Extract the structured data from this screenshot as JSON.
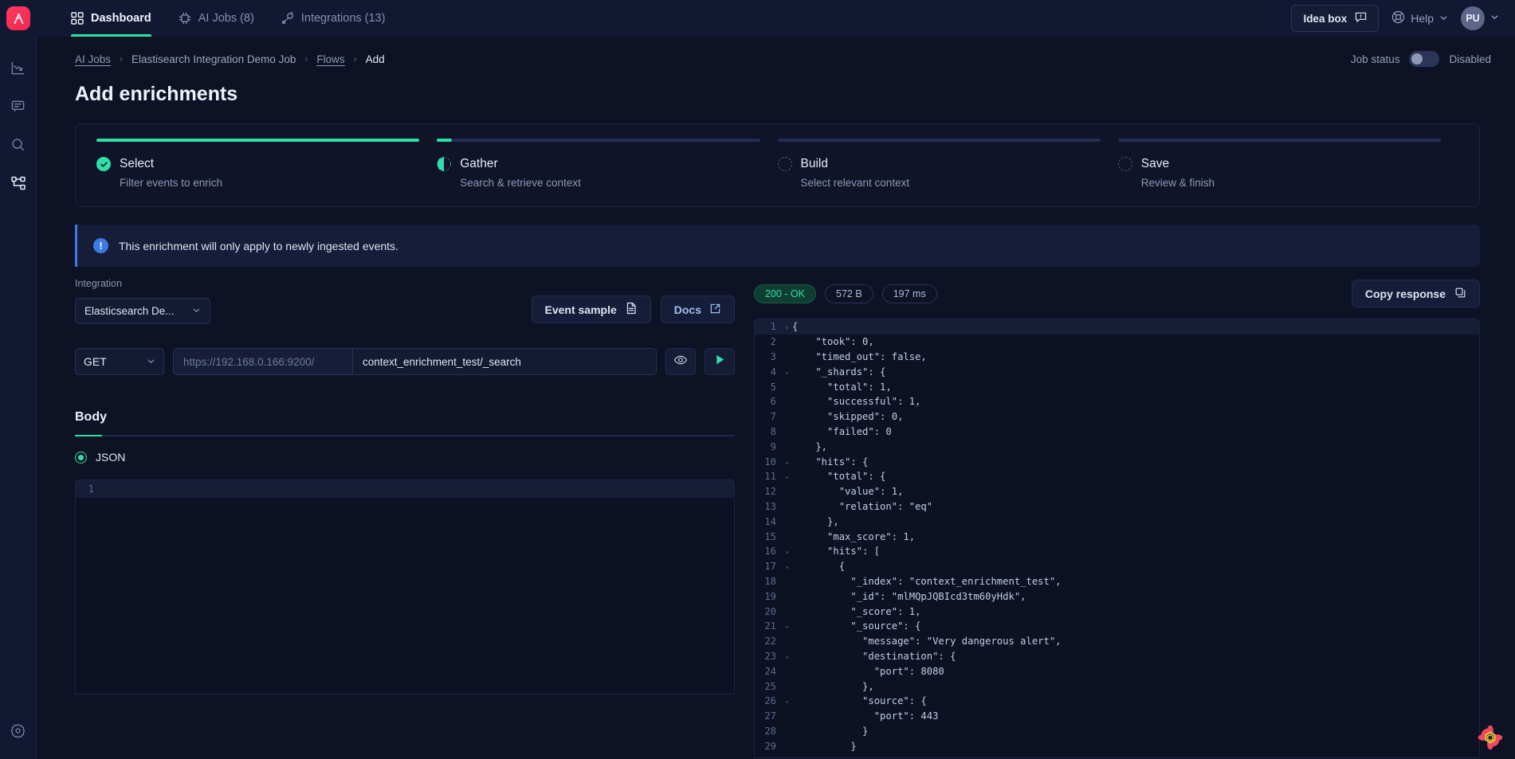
{
  "brand": {
    "logo_text": "Ai",
    "accent": "#2ee0a5",
    "brand_red": "#f2264f"
  },
  "topnav": {
    "tabs": [
      {
        "label": "Dashboard",
        "icon": "grid-icon",
        "active": true
      },
      {
        "label": "AI Jobs (8)",
        "icon": "chip-icon",
        "active": false
      },
      {
        "label": "Integrations (13)",
        "icon": "plug-icon",
        "active": false
      }
    ],
    "idea_box": "Idea box",
    "help": "Help",
    "avatar_initials": "PU"
  },
  "sidebar": {
    "items": [
      {
        "name": "analytics-icon"
      },
      {
        "name": "chat-icon"
      },
      {
        "name": "search-icon"
      },
      {
        "name": "flows-icon"
      }
    ],
    "bottom": {
      "name": "settings-icon"
    }
  },
  "breadcrumb": {
    "items": [
      {
        "label": "AI Jobs",
        "link": true
      },
      {
        "label": "Elastisearch Integration Demo Job",
        "link": false
      },
      {
        "label": "Flows",
        "link": true
      },
      {
        "label": "Add",
        "current": true
      }
    ],
    "separator": "›"
  },
  "job_status": {
    "label": "Job status",
    "value": "Disabled",
    "enabled": false
  },
  "page": {
    "title": "Add enrichments"
  },
  "stepper": {
    "steps": [
      {
        "name": "Select",
        "sub": "Filter events to enrich",
        "state": "done"
      },
      {
        "name": "Gather",
        "sub": "Search & retrieve context",
        "state": "active"
      },
      {
        "name": "Build",
        "sub": "Select relevant context",
        "state": "todo"
      },
      {
        "name": "Save",
        "sub": "Review & finish",
        "state": "todo"
      }
    ]
  },
  "banner": {
    "text": "This enrichment will only apply to newly ingested events.",
    "icon": "exclamation-icon"
  },
  "integration": {
    "label": "Integration",
    "selected": "Elasticsearch De...",
    "event_sample_label": "Event sample",
    "docs_label": "Docs"
  },
  "request": {
    "method": "GET",
    "base_url_placeholder": "https://192.168.0.166:9200/",
    "path": "context_enrichment_test/_search",
    "preview_icon": "eye-icon",
    "run_icon": "play-icon"
  },
  "body_section": {
    "title": "Body",
    "format": "JSON",
    "lines": [
      "1"
    ]
  },
  "response": {
    "status": "200 - OK",
    "size": "572 B",
    "time": "197 ms",
    "copy_label": "Copy response",
    "lines": [
      {
        "n": "1",
        "fold": "v",
        "text": "{"
      },
      {
        "n": "2",
        "fold": "",
        "text": "    \"took\": 0,"
      },
      {
        "n": "3",
        "fold": "",
        "text": "    \"timed_out\": false,"
      },
      {
        "n": "4",
        "fold": "v",
        "text": "    \"_shards\": {"
      },
      {
        "n": "5",
        "fold": "",
        "text": "      \"total\": 1,"
      },
      {
        "n": "6",
        "fold": "",
        "text": "      \"successful\": 1,"
      },
      {
        "n": "7",
        "fold": "",
        "text": "      \"skipped\": 0,"
      },
      {
        "n": "8",
        "fold": "",
        "text": "      \"failed\": 0"
      },
      {
        "n": "9",
        "fold": "",
        "text": "    },"
      },
      {
        "n": "10",
        "fold": "v",
        "text": "    \"hits\": {"
      },
      {
        "n": "11",
        "fold": "v",
        "text": "      \"total\": {"
      },
      {
        "n": "12",
        "fold": "",
        "text": "        \"value\": 1,"
      },
      {
        "n": "13",
        "fold": "",
        "text": "        \"relation\": \"eq\""
      },
      {
        "n": "14",
        "fold": "",
        "text": "      },"
      },
      {
        "n": "15",
        "fold": "",
        "text": "      \"max_score\": 1,"
      },
      {
        "n": "16",
        "fold": "v",
        "text": "      \"hits\": ["
      },
      {
        "n": "17",
        "fold": "v",
        "text": "        {"
      },
      {
        "n": "18",
        "fold": "",
        "text": "          \"_index\": \"context_enrichment_test\","
      },
      {
        "n": "19",
        "fold": "",
        "text": "          \"_id\": \"mlMQpJQBIcd3tm60yHdk\","
      },
      {
        "n": "20",
        "fold": "",
        "text": "          \"_score\": 1,"
      },
      {
        "n": "21",
        "fold": "v",
        "text": "          \"_source\": {"
      },
      {
        "n": "22",
        "fold": "",
        "text": "            \"message\": \"Very dangerous alert\","
      },
      {
        "n": "23",
        "fold": "v",
        "text": "            \"destination\": {"
      },
      {
        "n": "24",
        "fold": "",
        "text": "              \"port\": 8080"
      },
      {
        "n": "25",
        "fold": "",
        "text": "            },"
      },
      {
        "n": "26",
        "fold": "v",
        "text": "            \"source\": {"
      },
      {
        "n": "27",
        "fold": "",
        "text": "              \"port\": 443"
      },
      {
        "n": "28",
        "fold": "",
        "text": "            }"
      },
      {
        "n": "29",
        "fold": "",
        "text": "          }"
      }
    ]
  },
  "decoration": {
    "name": "flower-widget-icon"
  }
}
